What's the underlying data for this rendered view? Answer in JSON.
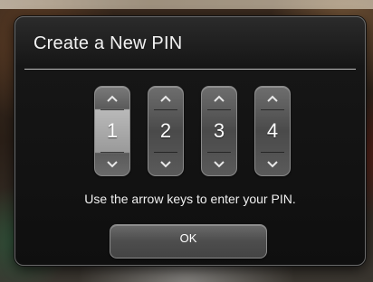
{
  "dialog": {
    "title": "Create a New PIN",
    "instruction": "Use the arrow keys to enter your PIN.",
    "ok_label": "OK"
  },
  "pin": {
    "digits": [
      "1",
      "2",
      "3",
      "4"
    ],
    "selected_index": 0
  },
  "icons": {
    "increment": "chevron-up-icon",
    "decrement": "chevron-down-icon"
  }
}
